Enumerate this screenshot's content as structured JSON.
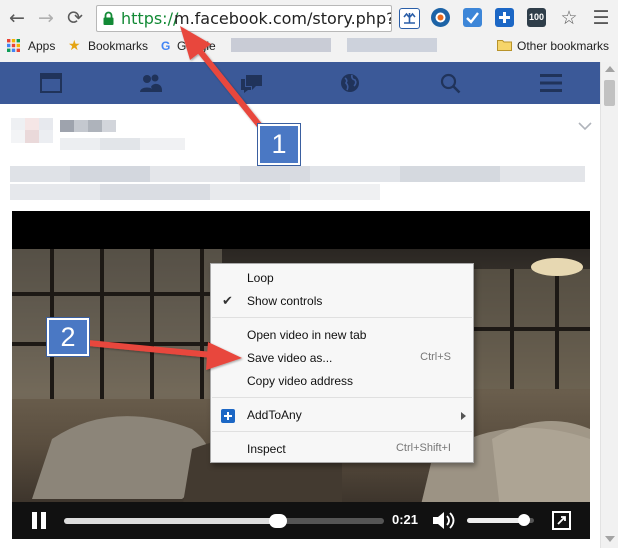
{
  "browser": {
    "url_scheme": "https://",
    "url_rest": "m.facebook.com/story.php?sto",
    "bookmarks": {
      "apps_label": "Apps",
      "bookmarks_label": "Bookmarks",
      "google_label": "Google",
      "other_label": "Other bookmarks"
    },
    "extension_badge": "100"
  },
  "fb_nav": {
    "icons": [
      "feed-icon",
      "friends-icon",
      "messages-icon",
      "globe-icon",
      "search-icon",
      "menu-icon"
    ]
  },
  "video": {
    "time": "0:21",
    "progress": 0.67,
    "volume": 0.85
  },
  "context_menu": {
    "loop": "Loop",
    "show_controls": "Show controls",
    "open_new_tab": "Open video in new tab",
    "save_as": "Save video as...",
    "save_shortcut": "Ctrl+S",
    "copy_address": "Copy video address",
    "addtoany": "AddToAny",
    "inspect": "Inspect",
    "inspect_shortcut": "Ctrl+Shift+I"
  },
  "callouts": {
    "step1": "1",
    "step2": "2"
  },
  "colors": {
    "fb_blue": "#3b5998",
    "url_green": "#138a36",
    "callout_blue": "#4a78c4",
    "arrow_red": "#e8463d"
  }
}
